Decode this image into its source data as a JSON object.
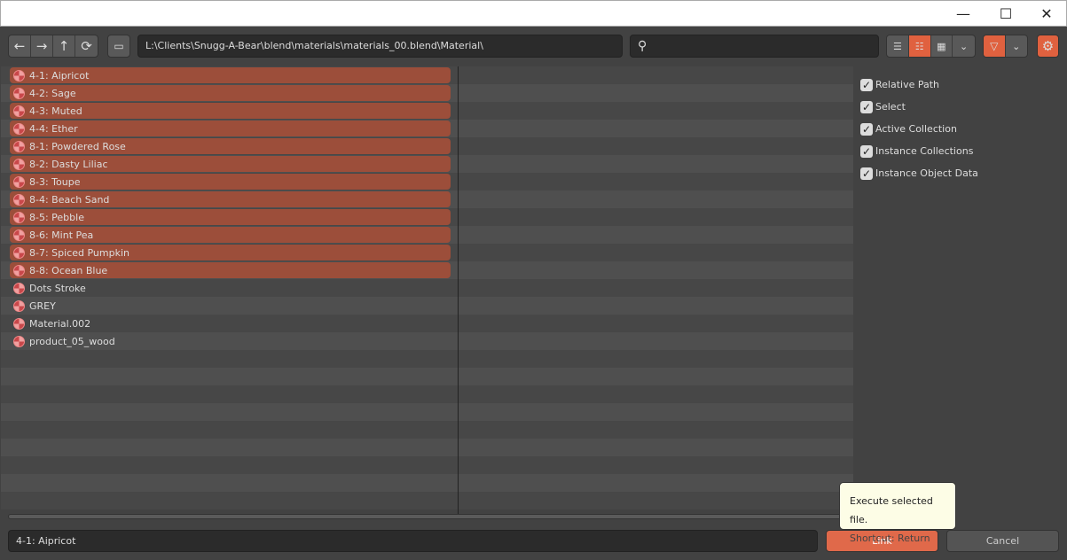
{
  "window": {
    "minimize": "—",
    "maximize": "☐",
    "close": "✕"
  },
  "toolbar": {
    "path": "L:\\Clients\\Snugg-A-Bear\\blend\\materials\\materials_00.blend\\Material\\",
    "search_placeholder": ""
  },
  "items": [
    {
      "label": "4-1: Aipricot",
      "selected": true
    },
    {
      "label": "4-2: Sage",
      "selected": true
    },
    {
      "label": "4-3: Muted",
      "selected": true
    },
    {
      "label": "4-4: Ether",
      "selected": true
    },
    {
      "label": "8-1: Powdered Rose",
      "selected": true
    },
    {
      "label": "8-2: Dasty Liliac",
      "selected": true
    },
    {
      "label": "8-3: Toupe",
      "selected": true
    },
    {
      "label": "8-4: Beach Sand",
      "selected": true
    },
    {
      "label": "8-5: Pebble",
      "selected": true
    },
    {
      "label": "8-6: Mint Pea",
      "selected": true
    },
    {
      "label": "8-7: Spiced Pumpkin",
      "selected": true
    },
    {
      "label": "8-8: Ocean Blue",
      "selected": true
    },
    {
      "label": "Dots Stroke",
      "selected": false
    },
    {
      "label": "GREY",
      "selected": false
    },
    {
      "label": "Material.002",
      "selected": false
    },
    {
      "label": "product_05_wood",
      "selected": false
    }
  ],
  "options": [
    {
      "label": "Relative Path",
      "checked": true
    },
    {
      "label": "Select",
      "checked": true
    },
    {
      "label": "Active Collection",
      "checked": true
    },
    {
      "label": "Instance Collections",
      "checked": true
    },
    {
      "label": "Instance Object Data",
      "checked": true
    }
  ],
  "footer": {
    "filename": "4-1: Aipricot",
    "link": "Link",
    "cancel": "Cancel"
  },
  "tooltip": {
    "line1": "Execute selected file.",
    "line2": "Shortcut: Return"
  },
  "colors": {
    "accent": "#e0613f",
    "selected_row": "#9c4e3a"
  }
}
